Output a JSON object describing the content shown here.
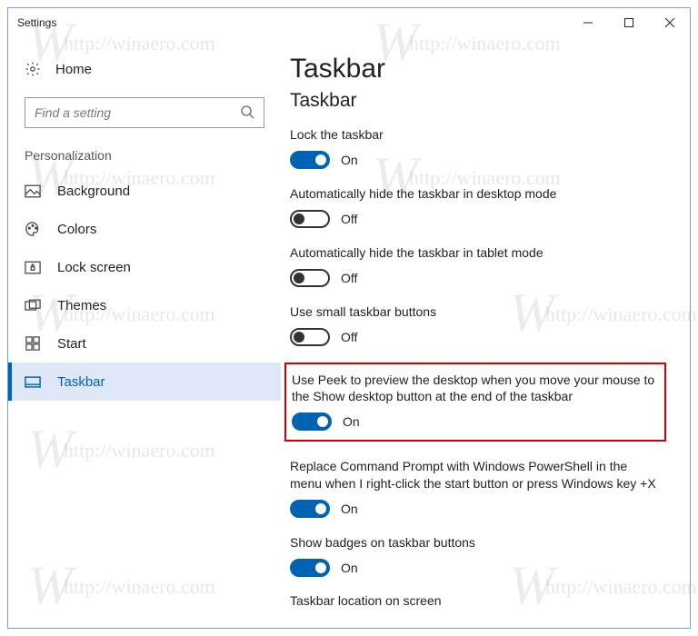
{
  "window": {
    "title": "Settings"
  },
  "sidebar": {
    "home_label": "Home",
    "search_placeholder": "Find a setting",
    "category": "Personalization",
    "items": [
      {
        "label": "Background",
        "icon": "image-icon"
      },
      {
        "label": "Colors",
        "icon": "palette-icon"
      },
      {
        "label": "Lock screen",
        "icon": "lock-icon"
      },
      {
        "label": "Themes",
        "icon": "themes-icon"
      },
      {
        "label": "Start",
        "icon": "start-icon"
      },
      {
        "label": "Taskbar",
        "icon": "taskbar-icon"
      }
    ]
  },
  "main": {
    "page_title": "Taskbar",
    "sub_title": "Taskbar",
    "settings": [
      {
        "label": "Lock the taskbar",
        "state": "On",
        "on": true
      },
      {
        "label": "Automatically hide the taskbar in desktop mode",
        "state": "Off",
        "on": false
      },
      {
        "label": "Automatically hide the taskbar in tablet mode",
        "state": "Off",
        "on": false
      },
      {
        "label": "Use small taskbar buttons",
        "state": "Off",
        "on": false
      },
      {
        "label": "Use Peek to preview the desktop when you move your mouse to the Show desktop button at the end of the taskbar",
        "state": "On",
        "on": true,
        "highlighted": true
      },
      {
        "label": "Replace Command Prompt with Windows PowerShell in the menu when I right-click the start button or press Windows key +X",
        "state": "On",
        "on": true
      },
      {
        "label": "Show badges on taskbar buttons",
        "state": "On",
        "on": true
      }
    ],
    "footer_heading": "Taskbar location on screen"
  },
  "watermark_text": "http://winaero.com"
}
